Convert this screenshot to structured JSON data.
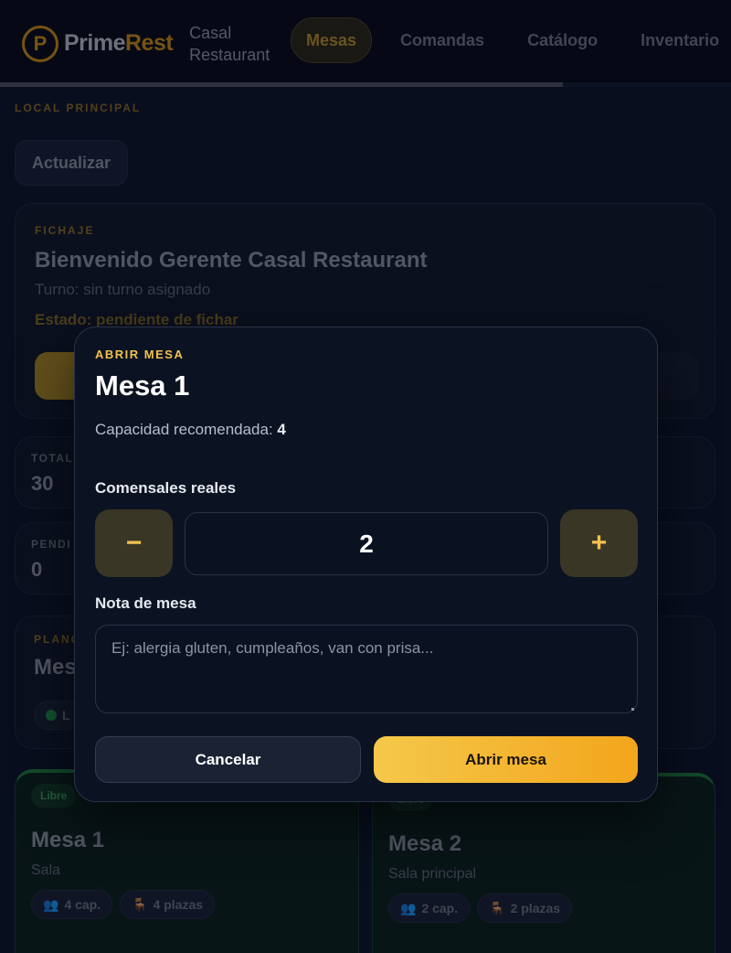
{
  "header": {
    "logo_letter": "P",
    "logo_prime": "Prime",
    "logo_rest": "Rest",
    "restaurant": "Casal Restaurant",
    "nav": [
      {
        "label": "Mesas",
        "active": true
      },
      {
        "label": "Comandas",
        "active": false
      },
      {
        "label": "Catálogo",
        "active": false
      },
      {
        "label": "Inventario",
        "active": false
      }
    ],
    "progress": 0.77
  },
  "page": {
    "location": "LOCAL PRINCIPAL",
    "refresh_label": "Actualizar",
    "clock_in": {
      "eyebrow": "FICHAJE",
      "welcome": "Bienvenido Gerente Casal Restaurant",
      "shift": "Turno: sin turno asignado",
      "status": "Estado: pendiente de fichar"
    },
    "stats": [
      {
        "label": "TOTAL",
        "value": "30"
      },
      {
        "label": "PENDI",
        "value": "0"
      }
    ],
    "plan": {
      "eyebrow": "PLANO",
      "title": "Mes",
      "legend_label": "L"
    },
    "tables": [
      {
        "badge": "Libre",
        "name": "Mesa 1",
        "zone": "Sala",
        "capacity": "4 cap.",
        "seats": "4 plazas"
      },
      {
        "badge": "Libre",
        "name": "Mesa 2",
        "zone": "Sala principal",
        "capacity": "2 cap.",
        "seats": "2 plazas"
      }
    ]
  },
  "modal": {
    "eyebrow": "ABRIR MESA",
    "title": "Mesa 1",
    "capacity_prefix": "Capacidad recomendada:",
    "capacity_value": "4",
    "diners_label": "Comensales reales",
    "decrement": "−",
    "diners_value": "2",
    "increment": "+",
    "note_label": "Nota de mesa",
    "note_placeholder": "Ej: alergia gluten, cumpleaños, van con prisa...",
    "cancel_label": "Cancelar",
    "confirm_label": "Abrir mesa"
  },
  "colors": {
    "accent": "#f2c14e",
    "background": "#0d1426",
    "free_green": "#1f7a3c"
  },
  "icons": {
    "people": "people-icon",
    "chair": "chair-icon"
  }
}
